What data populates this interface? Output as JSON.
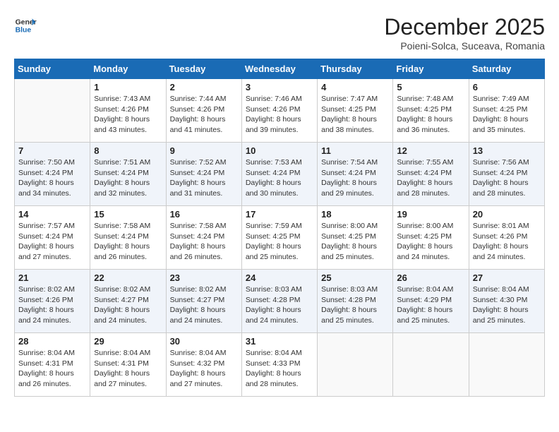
{
  "header": {
    "logo_general": "General",
    "logo_blue": "Blue",
    "month_year": "December 2025",
    "location": "Poieni-Solca, Suceava, Romania"
  },
  "weekdays": [
    "Sunday",
    "Monday",
    "Tuesday",
    "Wednesday",
    "Thursday",
    "Friday",
    "Saturday"
  ],
  "weeks": [
    [
      {
        "day": "",
        "info": ""
      },
      {
        "day": "1",
        "info": "Sunrise: 7:43 AM\nSunset: 4:26 PM\nDaylight: 8 hours\nand 43 minutes."
      },
      {
        "day": "2",
        "info": "Sunrise: 7:44 AM\nSunset: 4:26 PM\nDaylight: 8 hours\nand 41 minutes."
      },
      {
        "day": "3",
        "info": "Sunrise: 7:46 AM\nSunset: 4:26 PM\nDaylight: 8 hours\nand 39 minutes."
      },
      {
        "day": "4",
        "info": "Sunrise: 7:47 AM\nSunset: 4:25 PM\nDaylight: 8 hours\nand 38 minutes."
      },
      {
        "day": "5",
        "info": "Sunrise: 7:48 AM\nSunset: 4:25 PM\nDaylight: 8 hours\nand 36 minutes."
      },
      {
        "day": "6",
        "info": "Sunrise: 7:49 AM\nSunset: 4:25 PM\nDaylight: 8 hours\nand 35 minutes."
      }
    ],
    [
      {
        "day": "7",
        "info": "Sunrise: 7:50 AM\nSunset: 4:24 PM\nDaylight: 8 hours\nand 34 minutes."
      },
      {
        "day": "8",
        "info": "Sunrise: 7:51 AM\nSunset: 4:24 PM\nDaylight: 8 hours\nand 32 minutes."
      },
      {
        "day": "9",
        "info": "Sunrise: 7:52 AM\nSunset: 4:24 PM\nDaylight: 8 hours\nand 31 minutes."
      },
      {
        "day": "10",
        "info": "Sunrise: 7:53 AM\nSunset: 4:24 PM\nDaylight: 8 hours\nand 30 minutes."
      },
      {
        "day": "11",
        "info": "Sunrise: 7:54 AM\nSunset: 4:24 PM\nDaylight: 8 hours\nand 29 minutes."
      },
      {
        "day": "12",
        "info": "Sunrise: 7:55 AM\nSunset: 4:24 PM\nDaylight: 8 hours\nand 28 minutes."
      },
      {
        "day": "13",
        "info": "Sunrise: 7:56 AM\nSunset: 4:24 PM\nDaylight: 8 hours\nand 28 minutes."
      }
    ],
    [
      {
        "day": "14",
        "info": "Sunrise: 7:57 AM\nSunset: 4:24 PM\nDaylight: 8 hours\nand 27 minutes."
      },
      {
        "day": "15",
        "info": "Sunrise: 7:58 AM\nSunset: 4:24 PM\nDaylight: 8 hours\nand 26 minutes."
      },
      {
        "day": "16",
        "info": "Sunrise: 7:58 AM\nSunset: 4:24 PM\nDaylight: 8 hours\nand 26 minutes."
      },
      {
        "day": "17",
        "info": "Sunrise: 7:59 AM\nSunset: 4:25 PM\nDaylight: 8 hours\nand 25 minutes."
      },
      {
        "day": "18",
        "info": "Sunrise: 8:00 AM\nSunset: 4:25 PM\nDaylight: 8 hours\nand 25 minutes."
      },
      {
        "day": "19",
        "info": "Sunrise: 8:00 AM\nSunset: 4:25 PM\nDaylight: 8 hours\nand 24 minutes."
      },
      {
        "day": "20",
        "info": "Sunrise: 8:01 AM\nSunset: 4:26 PM\nDaylight: 8 hours\nand 24 minutes."
      }
    ],
    [
      {
        "day": "21",
        "info": "Sunrise: 8:02 AM\nSunset: 4:26 PM\nDaylight: 8 hours\nand 24 minutes."
      },
      {
        "day": "22",
        "info": "Sunrise: 8:02 AM\nSunset: 4:27 PM\nDaylight: 8 hours\nand 24 minutes."
      },
      {
        "day": "23",
        "info": "Sunrise: 8:02 AM\nSunset: 4:27 PM\nDaylight: 8 hours\nand 24 minutes."
      },
      {
        "day": "24",
        "info": "Sunrise: 8:03 AM\nSunset: 4:28 PM\nDaylight: 8 hours\nand 24 minutes."
      },
      {
        "day": "25",
        "info": "Sunrise: 8:03 AM\nSunset: 4:28 PM\nDaylight: 8 hours\nand 25 minutes."
      },
      {
        "day": "26",
        "info": "Sunrise: 8:04 AM\nSunset: 4:29 PM\nDaylight: 8 hours\nand 25 minutes."
      },
      {
        "day": "27",
        "info": "Sunrise: 8:04 AM\nSunset: 4:30 PM\nDaylight: 8 hours\nand 25 minutes."
      }
    ],
    [
      {
        "day": "28",
        "info": "Sunrise: 8:04 AM\nSunset: 4:31 PM\nDaylight: 8 hours\nand 26 minutes."
      },
      {
        "day": "29",
        "info": "Sunrise: 8:04 AM\nSunset: 4:31 PM\nDaylight: 8 hours\nand 27 minutes."
      },
      {
        "day": "30",
        "info": "Sunrise: 8:04 AM\nSunset: 4:32 PM\nDaylight: 8 hours\nand 27 minutes."
      },
      {
        "day": "31",
        "info": "Sunrise: 8:04 AM\nSunset: 4:33 PM\nDaylight: 8 hours\nand 28 minutes."
      },
      {
        "day": "",
        "info": ""
      },
      {
        "day": "",
        "info": ""
      },
      {
        "day": "",
        "info": ""
      }
    ]
  ]
}
